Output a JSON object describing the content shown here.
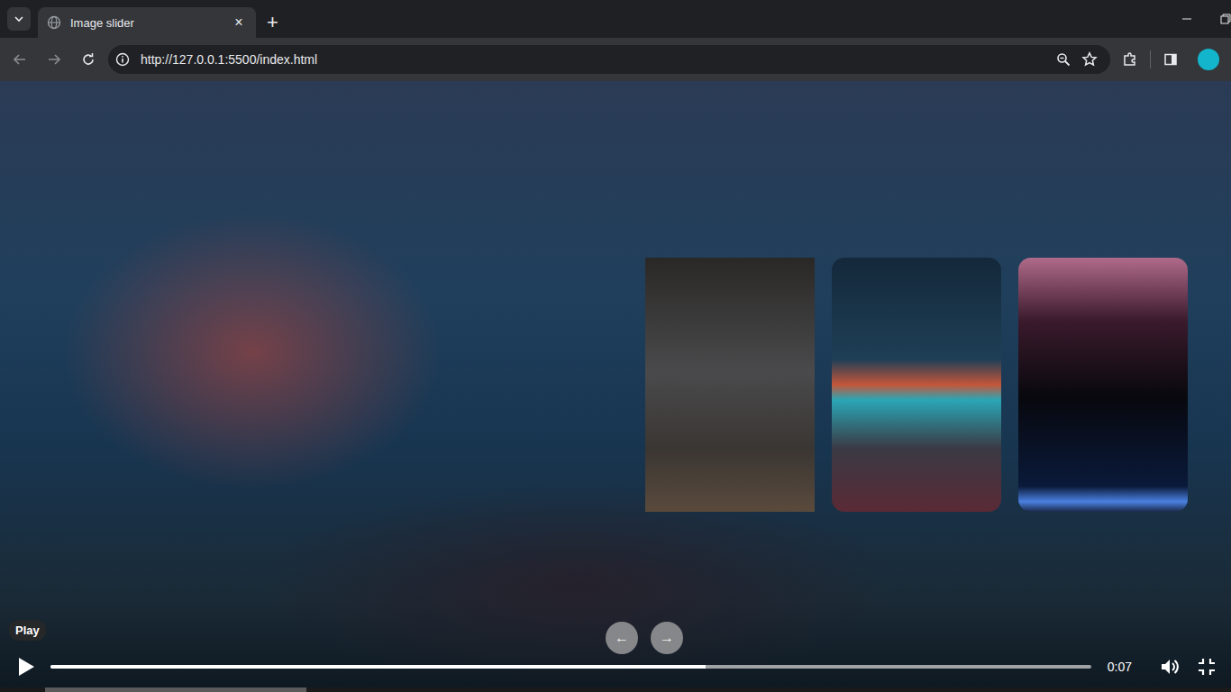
{
  "browser": {
    "tabs": [
      {
        "title": "Image slider",
        "selected": true,
        "close": "×"
      }
    ],
    "new_tab": "+",
    "url": "http://127.0.0.1:5500/index.html"
  },
  "slider": {
    "cards": [
      {
        "selected": true
      },
      {
        "selected": false
      },
      {
        "selected": false
      }
    ],
    "buttons": [
      {
        "label": "←"
      },
      {
        "label": "→"
      }
    ]
  },
  "video": {
    "tooltip": "Play",
    "time": "0:07",
    "level": 0.63,
    "playing": false
  },
  "page_scroll": {
    "level": 0.22
  }
}
